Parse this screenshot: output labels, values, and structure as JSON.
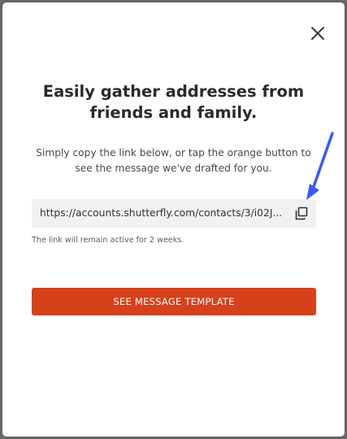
{
  "dialog": {
    "title": "Easily gather addresses from friends and family.",
    "description": "Simply copy the link below, or tap the orange button to see the message we've drafted for you.",
    "link": {
      "url_display": "https://accounts.shutterfly.com/contacts/3/i02J..."
    },
    "link_note": "The link will remain active for 2 weeks.",
    "cta_label": "SEE MESSAGE TEMPLATE"
  },
  "icons": {
    "close": "close-icon",
    "copy": "copy-icon",
    "annotation": "arrow-icon"
  },
  "colors": {
    "cta_background": "#d6411b",
    "annotation_arrow": "#3d5af1",
    "link_box_background": "#f1f1f1"
  }
}
